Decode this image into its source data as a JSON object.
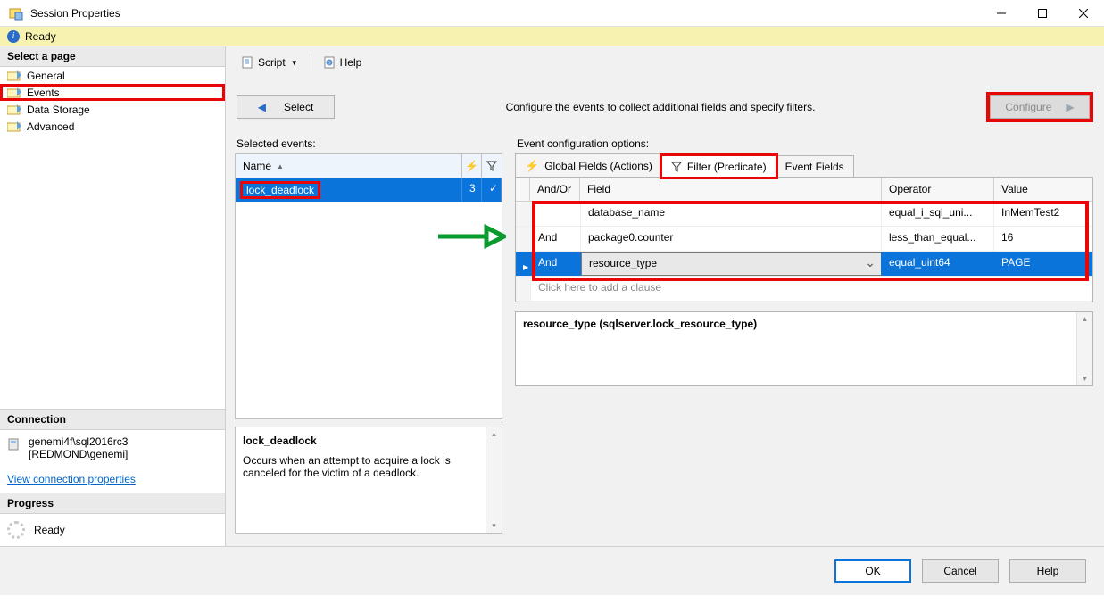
{
  "window": {
    "title": "Session Properties"
  },
  "status": {
    "text": "Ready"
  },
  "sidebar": {
    "select_page_label": "Select a page",
    "pages": [
      {
        "label": "General"
      },
      {
        "label": "Events"
      },
      {
        "label": "Data Storage"
      },
      {
        "label": "Advanced"
      }
    ],
    "connection_label": "Connection",
    "connection_line1": "genemi4f\\sql2016rc3",
    "connection_line2": "[REDMOND\\genemi]",
    "view_conn_props": "View connection properties",
    "progress_label": "Progress",
    "progress_status": "Ready"
  },
  "toolbar": {
    "script": "Script",
    "help": "Help"
  },
  "mid": {
    "select_btn": "Select",
    "desc": "Configure the events to collect additional fields and specify filters.",
    "configure_btn": "Configure"
  },
  "selected_events": {
    "label": "Selected events:",
    "header_name": "Name",
    "rows": [
      {
        "name": "lock_deadlock",
        "actions": "3",
        "filter": "✓"
      }
    ]
  },
  "event_desc": {
    "title": "lock_deadlock",
    "body": "Occurs when an attempt to acquire a lock is canceled for the victim of a deadlock."
  },
  "config_options": {
    "label": "Event configuration options:",
    "tabs": {
      "global_fields": "Global Fields (Actions)",
      "filter": "Filter (Predicate)",
      "event_fields": "Event Fields"
    },
    "pred_header": {
      "andor": "And/Or",
      "field": "Field",
      "operator": "Operator",
      "value": "Value"
    },
    "pred_rows": [
      {
        "andor": "",
        "field": "database_name",
        "operator": "equal_i_sql_uni...",
        "value": "InMemTest2"
      },
      {
        "andor": "And",
        "field": "package0.counter",
        "operator": "less_than_equal...",
        "value": "16"
      },
      {
        "andor": "And",
        "field": "resource_type",
        "operator": "equal_uint64",
        "value": "PAGE"
      }
    ],
    "add_clause_hint": "Click here to add a clause",
    "type_desc": "resource_type (sqlserver.lock_resource_type)"
  },
  "footer": {
    "ok": "OK",
    "cancel": "Cancel",
    "help": "Help"
  }
}
